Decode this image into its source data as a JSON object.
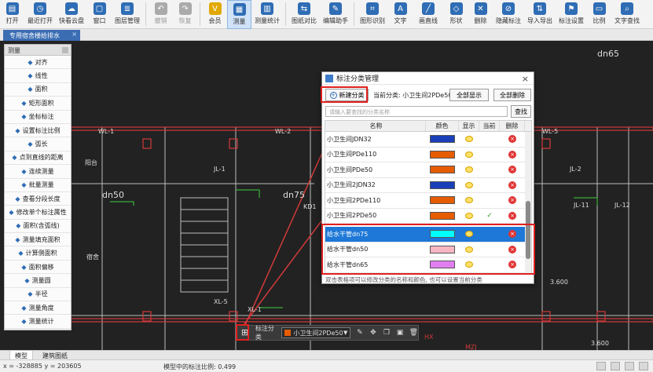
{
  "toolbar": {
    "items": [
      {
        "label": "打开",
        "icon": "folder-icon",
        "color": "#2f6db5"
      },
      {
        "label": "最近打开",
        "icon": "recent-icon",
        "color": "#2f6db5"
      },
      {
        "label": "快看云盘",
        "icon": "cloud-icon",
        "color": "#2f6db5"
      },
      {
        "label": "窗口",
        "icon": "window-icon",
        "color": "#2f6db5"
      },
      {
        "label": "图层管理",
        "icon": "layers-icon",
        "color": "#2f6db5"
      },
      {
        "label": "撤销",
        "icon": "undo-icon",
        "color": "#aaaaaa",
        "disabled": true
      },
      {
        "label": "恢复",
        "icon": "redo-icon",
        "color": "#aaaaaa",
        "disabled": true
      },
      {
        "label": "会员",
        "icon": "vip-icon",
        "color": "#e0a800"
      },
      {
        "label": "测量",
        "icon": "measure-icon",
        "color": "#2f6db5",
        "active": true
      },
      {
        "label": "测量统计",
        "icon": "stats-icon",
        "color": "#2f6db5"
      },
      {
        "label": "图纸对比",
        "icon": "compare-icon",
        "color": "#2f6db5"
      },
      {
        "label": "编辑助手",
        "icon": "edit-helper-icon",
        "color": "#2f6db5"
      },
      {
        "label": "图形识别",
        "icon": "shape-recog-icon",
        "color": "#2f6db5"
      },
      {
        "label": "文字",
        "icon": "text-icon",
        "color": "#2f6db5"
      },
      {
        "label": "画直线",
        "icon": "line-icon",
        "color": "#2f6db5"
      },
      {
        "label": "形状",
        "icon": "shape-icon",
        "color": "#2f6db5"
      },
      {
        "label": "删除",
        "icon": "delete-icon",
        "color": "#2f6db5"
      },
      {
        "label": "隐藏标注",
        "icon": "hide-annot-icon",
        "color": "#2f6db5"
      },
      {
        "label": "导入导出",
        "icon": "import-export-icon",
        "color": "#2f6db5"
      },
      {
        "label": "标注设置",
        "icon": "annot-settings-icon",
        "color": "#2f6db5"
      },
      {
        "label": "比例",
        "icon": "scale-icon",
        "color": "#2f6db5"
      },
      {
        "label": "文字查找",
        "icon": "text-search-icon",
        "color": "#2f6db5"
      }
    ]
  },
  "doc_tab": {
    "title": "专用宿舍楼给排水",
    "close": "×"
  },
  "measure_panel": {
    "title": "测量",
    "items": [
      {
        "label": "对齐",
        "icon": "align-icon"
      },
      {
        "label": "线性",
        "icon": "linear-icon"
      },
      {
        "label": "面积",
        "icon": "area-icon"
      },
      {
        "label": "矩形面积",
        "icon": "rect-area-icon"
      },
      {
        "label": "坐标标注",
        "icon": "coord-icon"
      },
      {
        "label": "设置标注比例",
        "icon": "set-scale-icon"
      },
      {
        "label": "弧长",
        "icon": "arc-icon"
      },
      {
        "label": "点到直线的距离",
        "icon": "point-line-icon"
      },
      {
        "label": "连续测量",
        "icon": "continuous-icon"
      },
      {
        "label": "批量测量",
        "icon": "batch-icon"
      },
      {
        "label": "查看分段长度",
        "icon": "segment-icon"
      },
      {
        "label": "修改单个标注属性",
        "icon": "modify-icon"
      },
      {
        "label": "面积(含弧线)",
        "icon": "arc-area-icon"
      },
      {
        "label": "测量填充面积",
        "icon": "fill-area-icon"
      },
      {
        "label": "计算侧面积",
        "icon": "side-area-icon"
      },
      {
        "label": "面积偏移",
        "icon": "area-offset-icon"
      },
      {
        "label": "测量圆",
        "icon": "circle-icon"
      },
      {
        "label": "半径",
        "icon": "radius-icon"
      },
      {
        "label": "测量角度",
        "icon": "angle-icon"
      },
      {
        "label": "测量统计",
        "icon": "stats-icon"
      }
    ]
  },
  "dialog": {
    "title": "标注分类管理",
    "close": "×",
    "new_button": "新建分类",
    "current_label": "当前分类: 小卫生间2PDe50",
    "show_all_button": "全部显示",
    "delete_all_button": "全部删除",
    "search_placeholder": "请输入要查找的分类名称",
    "search_button": "查找",
    "columns": [
      "名称",
      "颜色",
      "显示",
      "当前",
      "删除"
    ],
    "rows": [
      {
        "name": "小卫生间JDN32",
        "color": "#1a3fb8",
        "current": false,
        "selected": false
      },
      {
        "name": "小卫生间PDe110",
        "color": "#e65c00",
        "current": false,
        "selected": false
      },
      {
        "name": "小卫生间PDe50",
        "color": "#e65c00",
        "current": false,
        "selected": false
      },
      {
        "name": "小卫生间2JDN32",
        "color": "#1a3fb8",
        "current": false,
        "selected": false
      },
      {
        "name": "小卫生间2PDe110",
        "color": "#e65c00",
        "current": false,
        "selected": false
      },
      {
        "name": "小卫生间2PDe50",
        "color": "#e65c00",
        "current": true,
        "selected": false
      },
      {
        "name": "给水干管dn75",
        "color": "#00ffff",
        "current": false,
        "selected": true
      },
      {
        "name": "给水干管dn50",
        "color": "#f7b6c2",
        "current": false,
        "selected": false
      },
      {
        "name": "给水干管dn65",
        "color": "#e27ef0",
        "current": false,
        "selected": false
      }
    ],
    "footer": "双击表格项可以修改分类的名称和颜色, 也可以设置当前分类"
  },
  "floating_bar": {
    "label": "标注分类",
    "selected": "小卫生间2PDe50",
    "selected_color": "#e65c00"
  },
  "bottom_tabs": [
    "模型",
    "建筑图纸"
  ],
  "status": {
    "coords": "x = -328885  y = 203605",
    "scale": "模型中的标注比例: 0.499"
  },
  "cad_labels": [
    "WL-1",
    "WL-2",
    "WL-5",
    "JL-1",
    "JL-2",
    "JL-11",
    "JL-12",
    "XL-5",
    "XL-1",
    "dn65",
    "dn75",
    "dn50",
    "阳台",
    "宿舍",
    "3.600",
    "3.600",
    "HX",
    "MZJ",
    "KD1"
  ]
}
